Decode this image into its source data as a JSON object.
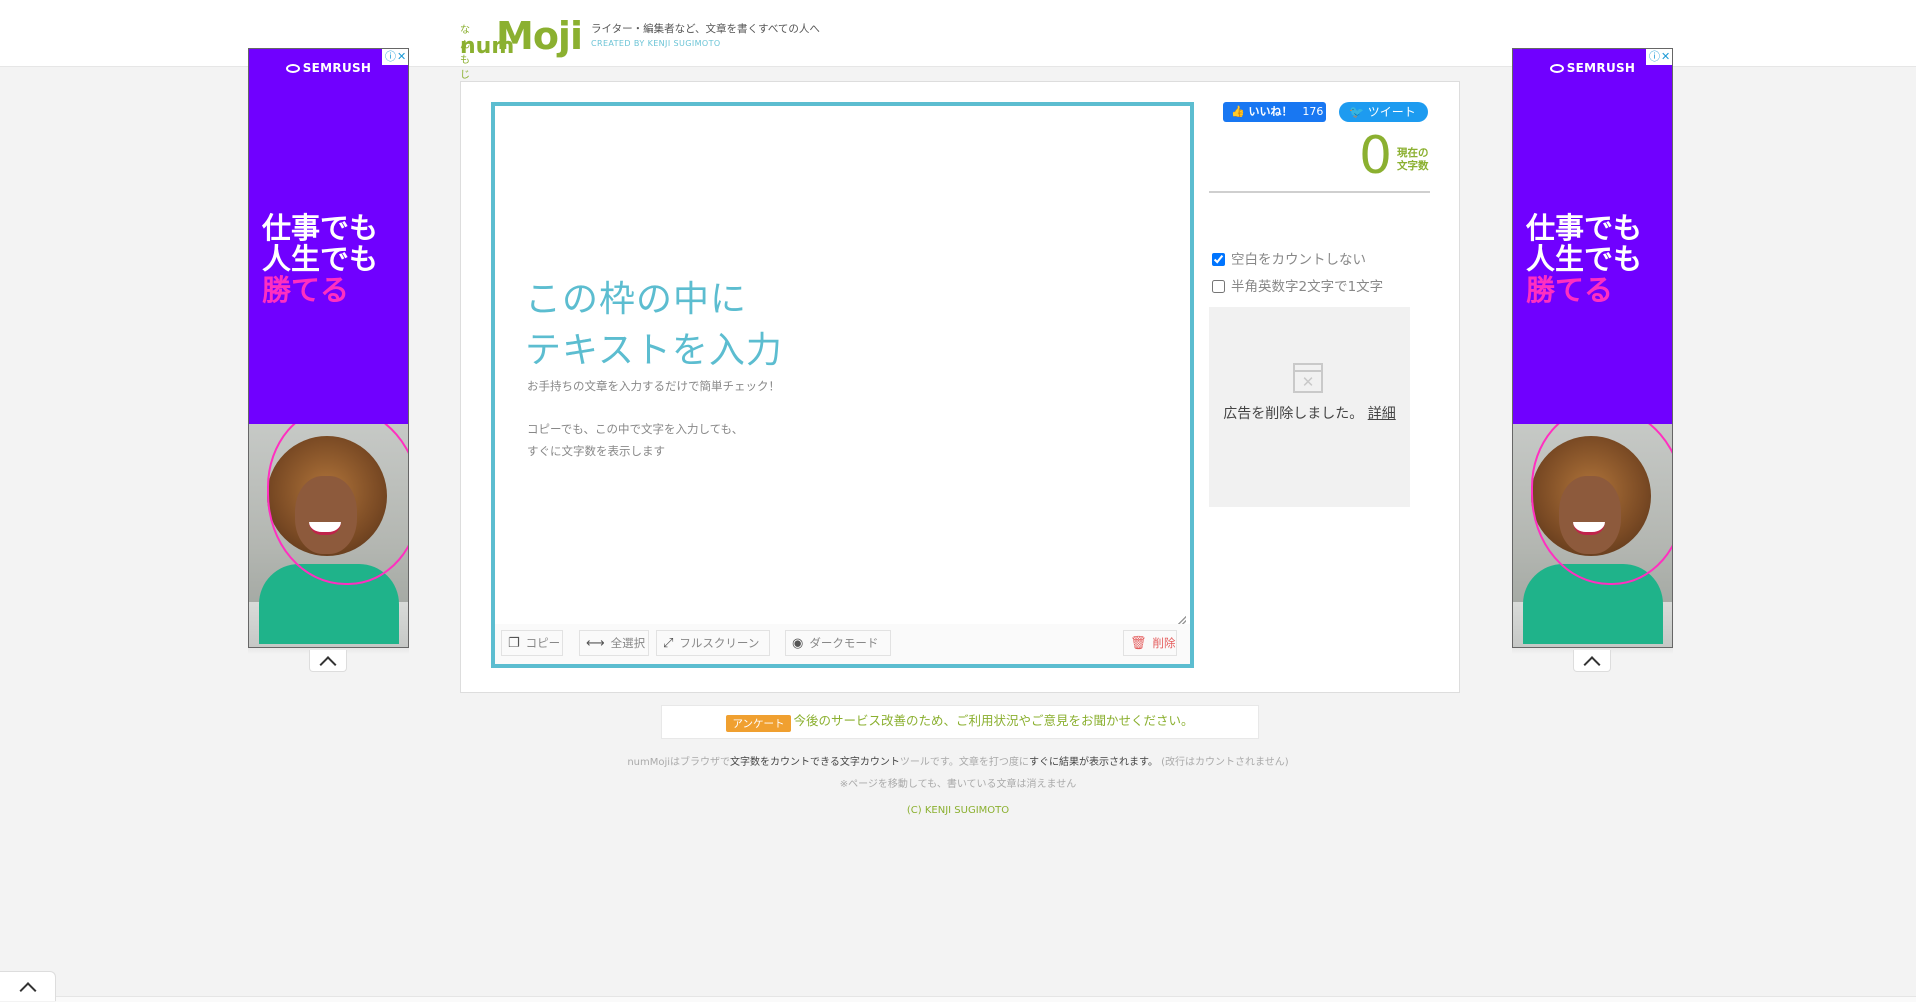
{
  "header": {
    "logo_small": "なんもじ",
    "logo_num": "num",
    "logo_moji": "Moji",
    "tagline": "ライター・編集者など、文章を書くすべての人へ",
    "credit": "CREATED BY KENJI SUGIMOTO"
  },
  "ad": {
    "brand": "SEMRUSH",
    "headline_line1": "仕事でも",
    "headline_line2": "人生でも",
    "headline_line3": "勝てる"
  },
  "editor": {
    "placeholder_line1": "この枠の中に",
    "placeholder_line2": "テキストを入力",
    "sub1": "お手持ちの文章を入力するだけで簡単チェック！",
    "sub2": "コピーでも、この中で文字を入力しても、",
    "sub3": "すぐに文字数を表示します"
  },
  "toolbar": {
    "copy": "コピー",
    "select_all": "全選択",
    "fullscreen": "フルスクリーン",
    "dark_mode": "ダークモード",
    "delete": "削除"
  },
  "social": {
    "like_label": "いいね！",
    "like_count": "176",
    "tweet_label": "ツイート"
  },
  "counter": {
    "value": "0",
    "label_line1": "現在の",
    "label_line2": "文字数"
  },
  "options": {
    "ignore_spaces": "空白をカウントしない",
    "ignore_spaces_checked": true,
    "halfwidth": "半角英数字2文字で1文字",
    "halfwidth_checked": false
  },
  "ad_removed": {
    "message": "広告を削除しました。",
    "detail": "詳細"
  },
  "survey": {
    "tag": "アンケート",
    "text": "今後のサービス改善のため、ご利用状況やご意見をお聞かせください。"
  },
  "footer": {
    "line1_a": "numMojiはブラウザで",
    "line1_b": "文字数をカウントできる文字カウント",
    "line1_c": "ツールです。文章を打つ度に",
    "line1_d": "すぐに結果が表示されます。",
    "line1_e": "(改行はカウントされません)",
    "line2": "※ページを移動しても、書いている文章は消えません",
    "copyright": "(C) KENJI SUGIMOTO"
  },
  "colors": {
    "brand_green": "#8bb030",
    "accent_cyan": "#5cbdd0",
    "ad_purple": "#7000ff",
    "ad_pink": "#ff2fc0"
  }
}
